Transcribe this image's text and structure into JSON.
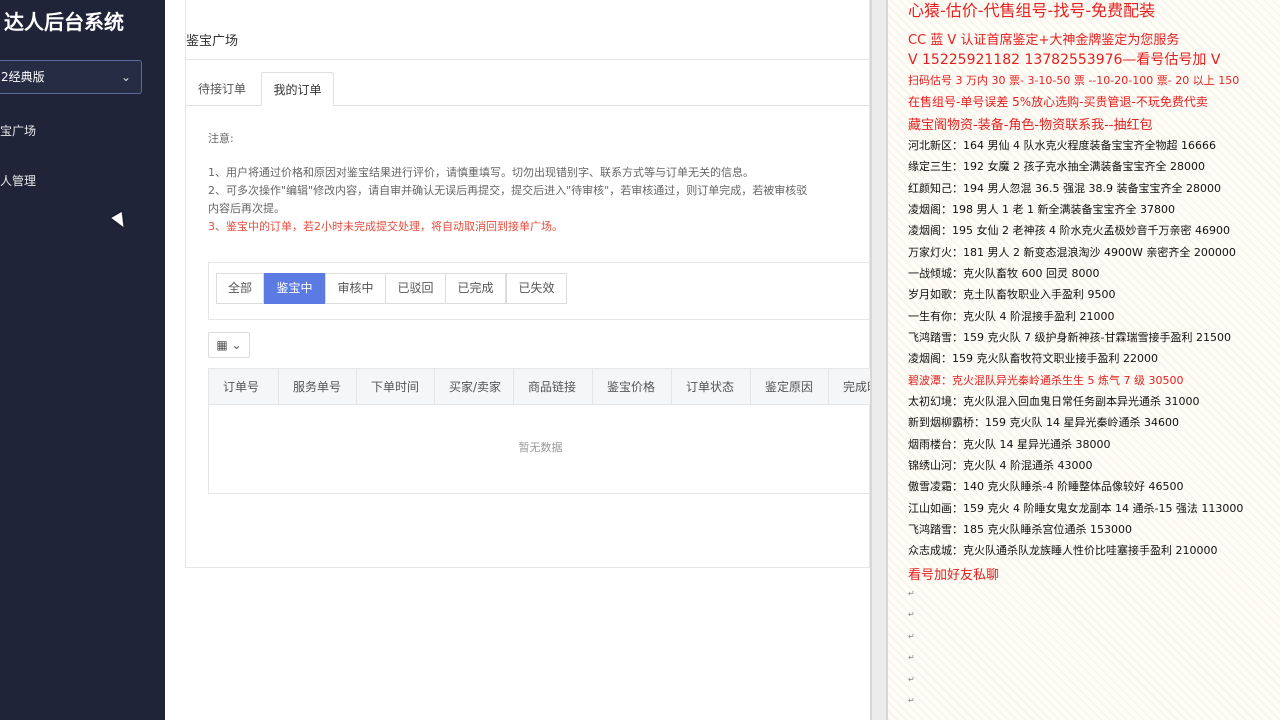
{
  "sidebar": {
    "brand": "达人后台系统",
    "version_select": "2经典版",
    "nav": [
      "宝广场",
      "人管理"
    ]
  },
  "main": {
    "page_title": "鉴宝广场",
    "tabs": [
      "待接订单",
      "我的订单"
    ],
    "notice": {
      "title": "注意:",
      "line1": "1、用户将通过价格和原因对鉴宝结果进行评价，请慎重填写。切勿出现错别字、联系方式等与订单无关的信息。",
      "line2": "2、可多次操作\"编辑\"修改内容，请自审并确认无误后再提交，提交后进入\"待审核\"，若审核通过，则订单完成，若被审核驳",
      "line3": "内容后再次提。",
      "line4": "3、鉴宝中的订单，若2小时未完成提交处理，将自动取消回到接单广场。"
    },
    "filters": [
      "全部",
      "鉴宝中",
      "审核中",
      "已驳回",
      "已完成",
      "已失效"
    ],
    "table_headers": [
      "订单号",
      "服务单号",
      "下单时间",
      "买家/卖家",
      "商品链接",
      "鉴宝价格",
      "订单状态",
      "鉴定原因",
      "完成时"
    ],
    "empty_text": "暂无数据"
  },
  "doc": {
    "lines": [
      "心猿-估价-代售组号-找号-免费配装",
      "CC 蓝 V 认证首席鉴定+大神金牌鉴定为您服务",
      "V 15225921182      13782553976—看号估号加 V",
      "扫码估号 3 万内 30 票- 3-10-50 票  --10-20-100 票- 20 以上 150",
      "在售组号-单号误差 5%放心选购-买贵管退-不玩免费代卖",
      "藏宝阁物资-装备-角色-物资联系我--抽红包",
      "河北新区：164 男仙 4 队水克火程度装备宝宝齐全物超 16666",
      "缘定三生：192 女魔 2 孩子克水抽全满装备宝宝齐全 28000",
      "红颜知己：194 男人忽混 36.5 强混 38.9 装备宝宝齐全 28000",
      "凌烟阁：198 男人 1 老 1 新全满装备宝宝齐全 37800",
      "凌烟阁：195 女仙 2 老神孩 4 阶水克火孟极妙音千万亲密 46900",
      "万家灯火：181 男人 2 新变态混浪淘沙 4900W 亲密齐全 200000",
      "一战倾城：克火队畜牧 600 回灵 8000",
      "岁月如歌：克土队畜牧职业入手盈利 9500",
      "一生有你：克火队 4 阶混接手盈利 21000",
      "飞鸿踏雪：159 克火队 7 级护身新神孩-甘霖瑞雪接手盈利 21500",
      "凌烟阁：159 克火队畜牧符文职业接手盈利 22000",
      "碧波潭：克火混队异光秦岭通杀生生 5 炼气 7 级 30500",
      "太初幻境：克火队混入回血鬼日常任务副本异光通杀 31000",
      "新到烟柳霸桥：159 克火队 14 星异光秦岭通杀 34600",
      "烟雨楼台：克火队 14 星异光通杀 38000",
      "锦绣山河：克火队 4 阶混通杀 43000",
      "傲雪凌霜：140 克火队睡杀-4 阶睡整体品像较好 46500",
      "江山如画：159 克火 4 阶睡女鬼女龙副本 14 通杀-15 强法 113000",
      "飞鸿踏雪：185 克火队睡杀宫位通杀 153000",
      "众志成城：克火队通杀队龙族睡人性价比哇塞接手盈利 210000",
      "看号加好友私聊"
    ],
    "paragraph_mark": "↵"
  }
}
